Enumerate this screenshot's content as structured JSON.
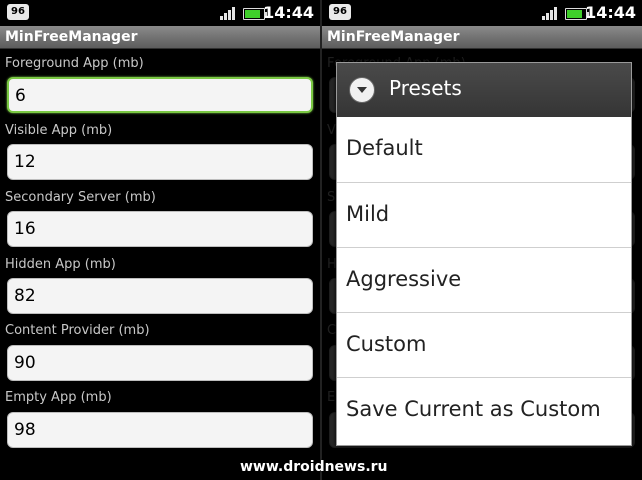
{
  "status": {
    "badge": "96",
    "time": "14:44",
    "battery_level": 0.85,
    "signal_bars": 4
  },
  "app": {
    "title": "MinFreeManager"
  },
  "fields": [
    {
      "label": "Foreground App (mb)",
      "value": "6"
    },
    {
      "label": "Visible App (mb)",
      "value": "12"
    },
    {
      "label": "Secondary Server (mb)",
      "value": "16"
    },
    {
      "label": "Hidden App (mb)",
      "value": "82"
    },
    {
      "label": "Content Provider (mb)",
      "value": "90"
    },
    {
      "label": "Empty App (mb)",
      "value": "98"
    }
  ],
  "dialog": {
    "title": "Presets",
    "items": [
      "Default",
      "Mild",
      "Aggressive",
      "Custom",
      "Save Current as Custom"
    ]
  },
  "watermark": "www.droidnews.ru",
  "colors": {
    "focus": "#7ac843",
    "battery": "#3fcf2a"
  }
}
